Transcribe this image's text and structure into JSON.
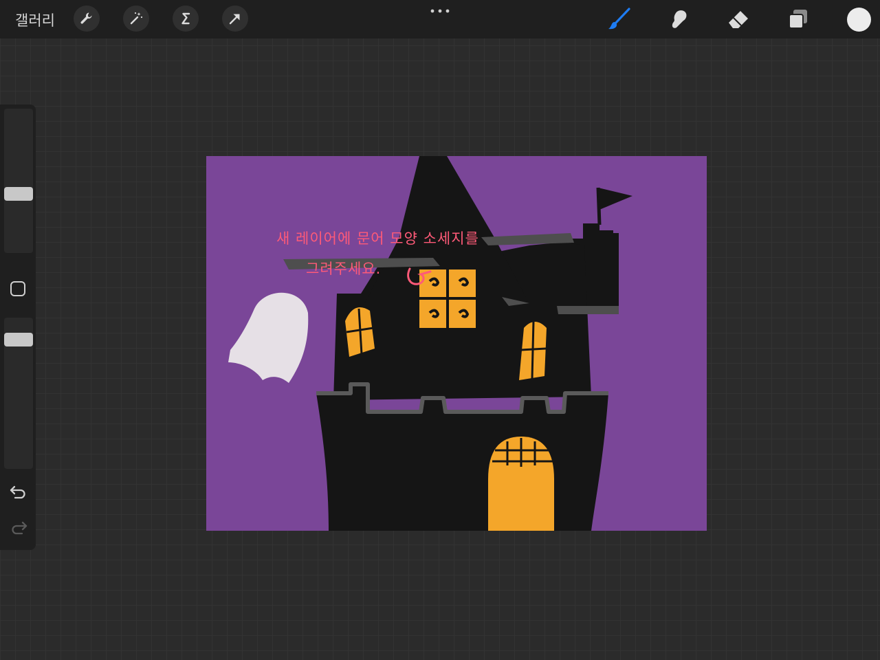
{
  "app": {
    "gallery_label": "갤러리"
  },
  "toolbar": {
    "left_tools": [
      "wrench-icon",
      "magic-wand-icon",
      "selection-icon",
      "transform-arrow-icon"
    ],
    "right_tools": [
      "brush-icon",
      "smudge-icon",
      "eraser-icon",
      "layers-icon"
    ],
    "active_tool": "brush-icon",
    "current_color": "#ececec",
    "accent_color": "#1e7cf2"
  },
  "sidebar": {
    "brush_size_level": 0.4,
    "opacity_level": 0.35,
    "icons": [
      "modify-square-icon",
      "undo-icon",
      "redo-icon"
    ]
  },
  "canvas": {
    "background_color": "#7a4698",
    "instruction_line1": "새 레이어에 문어 모양 소세지를",
    "instruction_line2": "그려주세요.",
    "instruction_color": "#ff5a78"
  }
}
